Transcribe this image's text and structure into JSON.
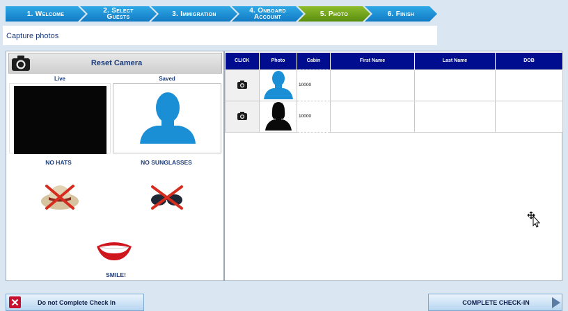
{
  "steps": [
    {
      "line1": "1. Welcome",
      "line2": ""
    },
    {
      "line1": "2. Select",
      "line2": "Guests"
    },
    {
      "line1": "3. Immigration",
      "line2": ""
    },
    {
      "line1": "4. Onboard",
      "line2": "Account"
    },
    {
      "line1": "5. Photo",
      "line2": ""
    },
    {
      "line1": "6. Finish",
      "line2": ""
    }
  ],
  "active_step": "5. Photo",
  "page_title": "Capture photos",
  "camera": {
    "reset_label": "Reset Camera",
    "live_label": "Live",
    "saved_label": "Saved"
  },
  "rules": {
    "no_hats": "NO HATS",
    "no_sunglasses": "NO SUNGLASSES",
    "smile": "SMILE!"
  },
  "table": {
    "headers": [
      "CLICK",
      "Photo",
      "Cabin",
      "First Name",
      "Last Name",
      "DOB"
    ],
    "rows": [
      {
        "cabin": "10000",
        "first_name": "",
        "last_name": "",
        "dob": "",
        "photo": "blue-silhouette"
      },
      {
        "cabin": "10000",
        "first_name": "",
        "last_name": "",
        "dob": "",
        "photo": "black-silhouette"
      }
    ]
  },
  "buttons": {
    "cancel": "Do not Complete Check In",
    "complete": "COMPLETE CHECK-IN"
  },
  "colors": {
    "step_blue": "#1a8fd6",
    "step_active_green": "#6d9c1a",
    "header_navy": "#000d8f",
    "silhouette_blue": "#1a8fd6"
  }
}
